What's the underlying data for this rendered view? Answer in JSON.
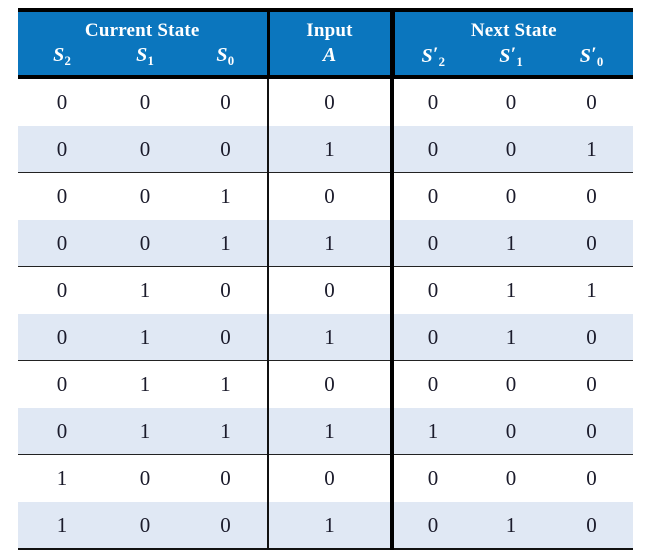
{
  "table": {
    "groups": [
      {
        "label": "Current State",
        "span": 3
      },
      {
        "label": "Input",
        "span": 1
      },
      {
        "label": "Next State",
        "span": 3
      }
    ],
    "columns": [
      {
        "key": "s2",
        "symbol": "S",
        "subscript": "2",
        "primed": false
      },
      {
        "key": "s1",
        "symbol": "S",
        "subscript": "1",
        "primed": false
      },
      {
        "key": "s0",
        "symbol": "S",
        "subscript": "0",
        "primed": false
      },
      {
        "key": "a",
        "symbol": "A",
        "subscript": "",
        "primed": false
      },
      {
        "key": "n2",
        "symbol": "S",
        "subscript": "2",
        "primed": true
      },
      {
        "key": "n1",
        "symbol": "S",
        "subscript": "1",
        "primed": true
      },
      {
        "key": "n0",
        "symbol": "S",
        "subscript": "0",
        "primed": true
      }
    ],
    "rows": [
      {
        "s2": "0",
        "s1": "0",
        "s0": "0",
        "a": "0",
        "n2": "0",
        "n1": "0",
        "n0": "0",
        "shaded": false
      },
      {
        "s2": "0",
        "s1": "0",
        "s0": "0",
        "a": "1",
        "n2": "0",
        "n1": "0",
        "n0": "1",
        "shaded": true
      },
      {
        "s2": "0",
        "s1": "0",
        "s0": "1",
        "a": "0",
        "n2": "0",
        "n1": "0",
        "n0": "0",
        "shaded": false
      },
      {
        "s2": "0",
        "s1": "0",
        "s0": "1",
        "a": "1",
        "n2": "0",
        "n1": "1",
        "n0": "0",
        "shaded": true
      },
      {
        "s2": "0",
        "s1": "1",
        "s0": "0",
        "a": "0",
        "n2": "0",
        "n1": "1",
        "n0": "1",
        "shaded": false
      },
      {
        "s2": "0",
        "s1": "1",
        "s0": "0",
        "a": "1",
        "n2": "0",
        "n1": "1",
        "n0": "0",
        "shaded": true
      },
      {
        "s2": "0",
        "s1": "1",
        "s0": "1",
        "a": "0",
        "n2": "0",
        "n1": "0",
        "n0": "0",
        "shaded": false
      },
      {
        "s2": "0",
        "s1": "1",
        "s0": "1",
        "a": "1",
        "n2": "1",
        "n1": "0",
        "n0": "0",
        "shaded": true
      },
      {
        "s2": "1",
        "s1": "0",
        "s0": "0",
        "a": "0",
        "n2": "0",
        "n1": "0",
        "n0": "0",
        "shaded": false
      },
      {
        "s2": "1",
        "s1": "0",
        "s0": "0",
        "a": "1",
        "n2": "0",
        "n1": "1",
        "n0": "0",
        "shaded": true
      }
    ]
  },
  "colors": {
    "header_blue": "#0b76be",
    "shaded_row": "#e0e8f4",
    "rule_black": "#000000",
    "text": "#1b1b2b",
    "header_text": "#ffffff"
  }
}
